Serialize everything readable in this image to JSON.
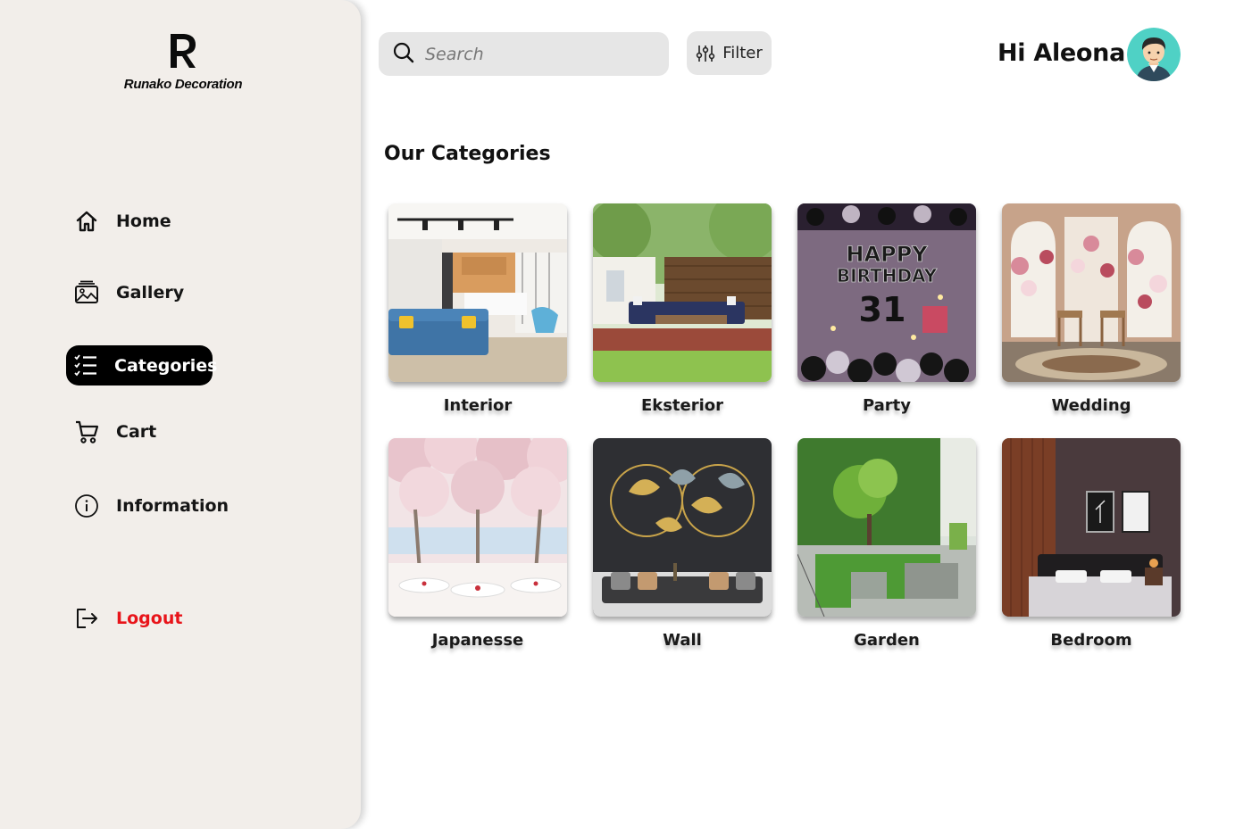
{
  "brand": {
    "name": "Runako Decoration"
  },
  "sidebar": {
    "items": [
      {
        "label": "Home",
        "icon": "home-icon"
      },
      {
        "label": "Gallery",
        "icon": "gallery-icon"
      },
      {
        "label": "Categories",
        "icon": "list-icon",
        "active": true
      },
      {
        "label": "Cart",
        "icon": "cart-icon"
      },
      {
        "label": "Information",
        "icon": "info-icon"
      }
    ],
    "logout": {
      "label": "Logout",
      "icon": "logout-icon",
      "color": "#e8141a"
    }
  },
  "header": {
    "search": {
      "placeholder": "Search",
      "value": ""
    },
    "filter_label": "Filter",
    "greeting": "Hi Aleona"
  },
  "main": {
    "title": "Our Categories",
    "categories": [
      {
        "label": "Interior"
      },
      {
        "label": "Eksterior"
      },
      {
        "label": "Party"
      },
      {
        "label": "Wedding"
      },
      {
        "label": "Japanesse"
      },
      {
        "label": "Wall"
      },
      {
        "label": "Garden"
      },
      {
        "label": "Bedroom"
      }
    ]
  },
  "party_banner": {
    "line1": "HAPPY",
    "line2": "BIRTHDAY",
    "number": "31"
  },
  "colors": {
    "accent": "#000000",
    "sidebar_bg": "#f2eeea",
    "logout": "#e8141a"
  }
}
